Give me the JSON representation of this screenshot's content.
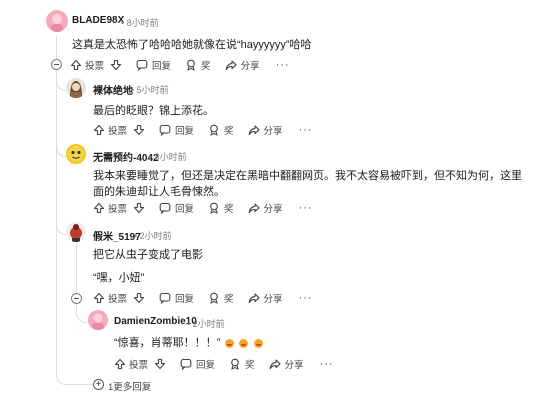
{
  "labels": {
    "upvote": "投票",
    "reply": "回复",
    "award": "奖",
    "share": "分享",
    "more": "···"
  },
  "comments": [
    {
      "id": "c1",
      "username": "BLADE98X",
      "time": "8小时前",
      "body": "这真是太恐怖了哈哈哈她就像在说“hayyyyyy”哈哈"
    },
    {
      "id": "c2",
      "username": "裸体绝地",
      "time": "5小时前",
      "body": "最后的眨眼？锦上添花。"
    },
    {
      "id": "c3",
      "username": "无需预约-4042",
      "time": "3小时前",
      "body": "我本来要睡觉了，但还是决定在黑暗中翻翻网页。我不太容易被吓到，但不知为何，这里面的朱迪却让人毛骨悚然。"
    },
    {
      "id": "c4",
      "username": "假米_5197",
      "time": "2小时前",
      "body_line1": "把它从虫子变成了电影",
      "body_line2": "“嘿，小妞”"
    },
    {
      "id": "c5",
      "username": "DamienZombie10",
      "time": "2小时前",
      "body": "“惊喜，肖蒂耶！！！”",
      "emoji": [
        "grinning-face",
        "grinning-face",
        "grinning-face"
      ]
    }
  ],
  "load_more": "1更多回复",
  "colors": {
    "avatar_pink": "#f3aabd",
    "avatar_yellow": "#f5c518",
    "thread_line": "#d9dde0",
    "meta_gray": "#7c7c7c"
  }
}
